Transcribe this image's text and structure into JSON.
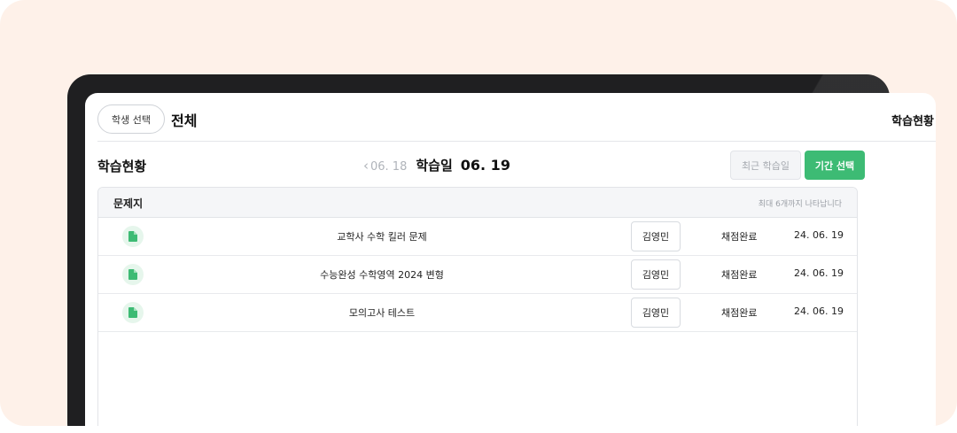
{
  "header": {
    "student_select_label": "학생 선택",
    "scope_title": "전체",
    "right_title": "학습현황"
  },
  "section": {
    "title": "학습현황",
    "prev_date": "06. 18",
    "date_label": "학습일",
    "current_date": "06. 19",
    "recent_button": "최근 학습일",
    "period_button": "기간 선택"
  },
  "table": {
    "header_title": "문제지",
    "header_note": "최대 6개까지 나타납니다",
    "rows": [
      {
        "icon": "document-icon",
        "title": "교학사 수학 킬러 문제",
        "teacher": "김영민",
        "status": "채점완료",
        "date": "24. 06. 19"
      },
      {
        "icon": "document-icon",
        "title": "수능완성 수학영역 2024 변형",
        "teacher": "김영민",
        "status": "채점완료",
        "date": "24. 06. 19"
      },
      {
        "icon": "document-icon",
        "title": "모의고사 테스트",
        "teacher": "김영민",
        "status": "채점완료",
        "date": "24. 06. 19"
      }
    ]
  },
  "colors": {
    "accent": "#3dbb74",
    "backdrop": "#fef1e9",
    "device_frame": "#1f1f21"
  }
}
